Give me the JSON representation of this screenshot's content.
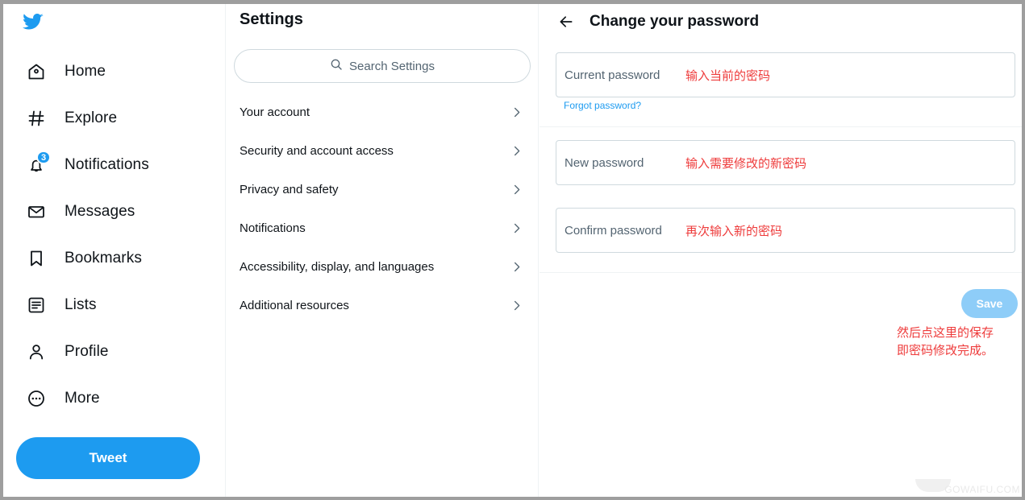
{
  "colors": {
    "brand_blue": "#1d9bf0",
    "save_disabled_blue": "#8ecdf8",
    "annotation_red": "#ee3b3b",
    "text_primary": "#0f1419",
    "text_secondary": "#536471",
    "border": "#cfd9de",
    "divider": "#eff3f4",
    "page_frame_gray": "#9e9e9e"
  },
  "left_nav": {
    "logo_icon": "twitter-bird-icon",
    "items": [
      {
        "label": "Home",
        "icon": "home-icon",
        "badge": ""
      },
      {
        "label": "Explore",
        "icon": "hashtag-icon",
        "badge": ""
      },
      {
        "label": "Notifications",
        "icon": "bell-icon",
        "badge": "3"
      },
      {
        "label": "Messages",
        "icon": "envelope-icon",
        "badge": ""
      },
      {
        "label": "Bookmarks",
        "icon": "bookmark-icon",
        "badge": ""
      },
      {
        "label": "Lists",
        "icon": "list-icon",
        "badge": ""
      },
      {
        "label": "Profile",
        "icon": "person-icon",
        "badge": ""
      },
      {
        "label": "More",
        "icon": "ellipsis-circle-icon",
        "badge": ""
      }
    ],
    "tweet_button_label": "Tweet"
  },
  "settings": {
    "title": "Settings",
    "search": {
      "placeholder": "Search Settings",
      "value": "",
      "icon": "search-icon"
    },
    "items": [
      {
        "label": "Your account",
        "chevron": "chevron-right-icon"
      },
      {
        "label": "Security and account access",
        "chevron": "chevron-right-icon"
      },
      {
        "label": "Privacy and safety",
        "chevron": "chevron-right-icon"
      },
      {
        "label": "Notifications",
        "chevron": "chevron-right-icon"
      },
      {
        "label": "Accessibility, display, and languages",
        "chevron": "chevron-right-icon"
      },
      {
        "label": "Additional resources",
        "chevron": "chevron-right-icon"
      }
    ]
  },
  "main": {
    "back_icon": "arrow-left-icon",
    "title": "Change your password",
    "fields": [
      {
        "label": "Current password",
        "value": "",
        "annotation": "输入当前的密码"
      },
      {
        "label": "New password",
        "value": "",
        "annotation": "输入需要修改的新密码"
      },
      {
        "label": "Confirm password",
        "value": "",
        "annotation": "再次输入新的密码"
      }
    ],
    "forgot_password_label": "Forgot password?",
    "save_button_label": "Save",
    "save_annotation": "然后点这里的保存\n即密码修改完成。"
  },
  "watermark": {
    "text": "GOWAIFU.COM"
  }
}
